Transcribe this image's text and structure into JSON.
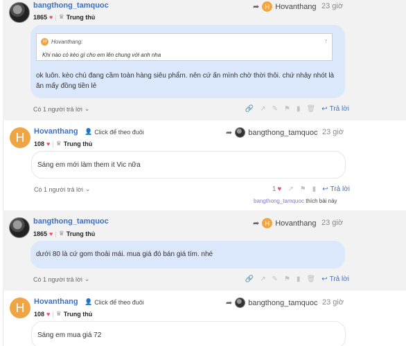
{
  "posts": [
    {
      "author": "bangthong_tamquoc",
      "points": "1865",
      "rank": "Trung thủ",
      "reply_to": "Hovanthang",
      "reply_to_initial": "H",
      "time": "23 giờ",
      "quote": {
        "initial": "H",
        "author": "Hovanthang:",
        "text": "Khi nào có kèo gì cho em lên chung với anh nha"
      },
      "content": "ok luôn. kèo chú đang cầm toàn hàng siêu phẩm. nên cứ ấn mình chờ thời thôi. chứ nhảy nhót là ăn mấy đồng tiền lẻ",
      "replies_label": "Có 1 người trả lời",
      "reply_label": "Trả lời"
    },
    {
      "author": "Hovanthang",
      "initial": "H",
      "points": "108",
      "rank": "Trung thủ",
      "follow_label": "Click để theo đuôi",
      "reply_to": "bangthong_tamquoc",
      "time": "23 giờ",
      "content": "Sáng em mới làm them it Vic nữa",
      "replies_label": "Có 1 người trả lời",
      "like_count": "1",
      "reply_label": "Trả lời",
      "liked_by": "bangthong_tamquoc",
      "liked_suffix": "thích bài này"
    },
    {
      "author": "bangthong_tamquoc",
      "points": "1865",
      "rank": "Trung thủ",
      "reply_to": "Hovanthang",
      "reply_to_initial": "H",
      "time": "23 giờ",
      "content": "dưới 80 là cứ gom thoải mái. mua giá đó bán giá tím. nhé",
      "replies_label": "Có 1 người trả lời",
      "reply_label": "Trả lời"
    },
    {
      "author": "Hovanthang",
      "initial": "H",
      "points": "108",
      "rank": "Trung thủ",
      "follow_label": "Click để theo đuôi",
      "reply_to": "bangthong_tamquoc",
      "time": "23 giờ",
      "content": "Sáng em mua giá 72"
    }
  ],
  "colors": {
    "username": "#3d6fc1",
    "avatar_letter_bg": "#f0a545",
    "bubble_blue": "#dbe7fb",
    "heart": "#e84d6a"
  },
  "icons": [
    "user-avatar",
    "heart-icon",
    "medal-icon",
    "reply-arrow-icon",
    "person-plus-icon",
    "chevron-down-icon",
    "link-icon",
    "share-icon",
    "edit-icon",
    "flag-icon",
    "bookmark-icon",
    "trash-icon",
    "reply-icon",
    "arrow-up-icon"
  ]
}
